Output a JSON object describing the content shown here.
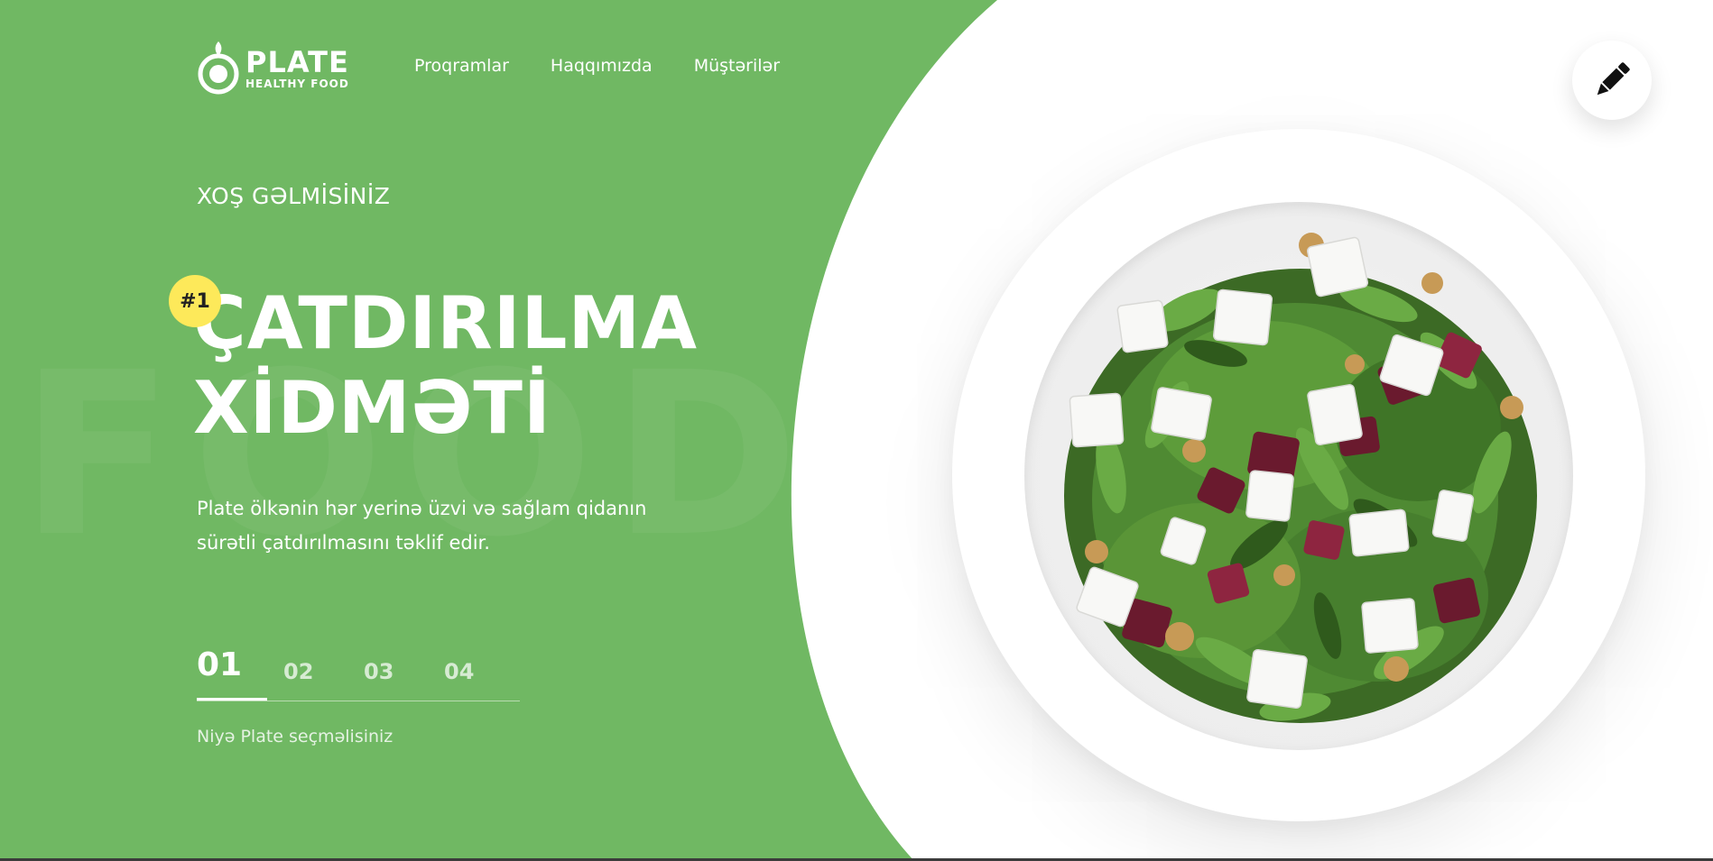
{
  "brand": {
    "name": "PLATE",
    "tagline": "HEALTHY FOOD"
  },
  "nav": {
    "items": [
      {
        "label": "Proqramlar"
      },
      {
        "label": "Haqqımızda"
      },
      {
        "label": "Müştərilər"
      }
    ]
  },
  "hero": {
    "eyebrow": "XOŞ GƏLMİSİNİZ",
    "badge": "#1",
    "headline_line1": "ÇATDIRILMA",
    "headline_line2": "XİDMƏTİ",
    "subtitle_line1": "Plate ölkənin hər yerinə üzvi və sağlam qidanın",
    "subtitle_line2": "sürətli çatdırılmasını təklif edir.",
    "watermark": "FOOD"
  },
  "steps": {
    "items": [
      {
        "label": "01",
        "active": true
      },
      {
        "label": "02",
        "active": false
      },
      {
        "label": "03",
        "active": false
      },
      {
        "label": "04",
        "active": false
      }
    ],
    "caption": "Niyə Plate seçməlisiniz"
  },
  "edit_button": {
    "icon": "pencil-icon"
  },
  "colors": {
    "primary_green": "#70b863",
    "badge_yellow": "#fde95a",
    "background": "#ffffff"
  }
}
